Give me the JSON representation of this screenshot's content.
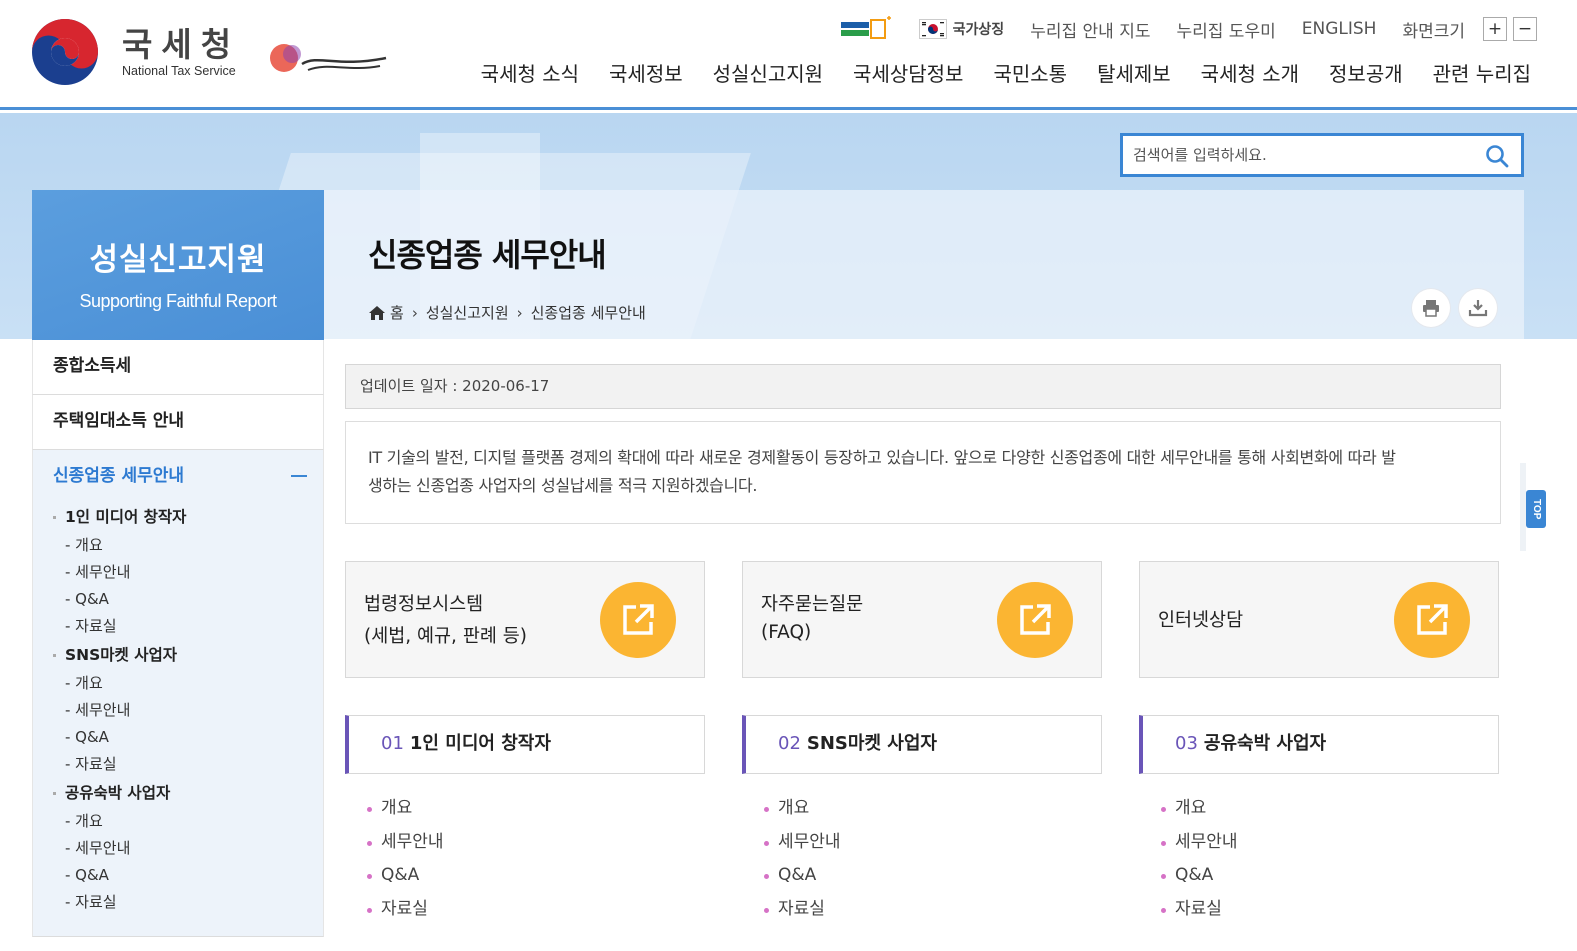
{
  "header": {
    "logo_kr": "국세청",
    "logo_en": "National Tax Service",
    "util": {
      "gov_label": "국가상징",
      "map": "누리집 안내 지도",
      "help": "누리집 도우미",
      "english": "ENGLISH",
      "zoom_label": "화면크기",
      "zoom_in": "+",
      "zoom_out": "−"
    },
    "gnb": [
      "국세청 소식",
      "국세정보",
      "성실신고지원",
      "국세상담정보",
      "국민소통",
      "탈세제보",
      "국세청 소개",
      "정보공개",
      "관련 누리집"
    ]
  },
  "search": {
    "placeholder": "검색어를 입력하세요."
  },
  "side_head": {
    "title": "성실신고지원",
    "subtitle": "Supporting Faithful Report"
  },
  "page": {
    "title": "신종업종 세무안내",
    "breadcrumb": [
      "홈",
      "성실신고지원",
      "신종업종 세무안내"
    ]
  },
  "sidebar": {
    "items": [
      "종합소득세",
      "주택임대소득 안내"
    ],
    "open": {
      "label": "신종업종 세무안내",
      "groups": [
        {
          "title": "1인 미디어 창작자",
          "subs": [
            "- 개요",
            "- 세무안내",
            "- Q&A",
            "- 자료실"
          ]
        },
        {
          "title": "SNS마켓 사업자",
          "subs": [
            "- 개요",
            "- 세무안내",
            "- Q&A",
            "- 자료실"
          ]
        },
        {
          "title": "공유숙박 사업자",
          "subs": [
            "- 개요",
            "- 세무안내",
            "- Q&A",
            "- 자료실"
          ]
        }
      ]
    }
  },
  "content": {
    "update": "업데이트 일자 : 2020-06-17",
    "intro_line1": "IT 기술의 발전, 디지털 플랫폼 경제의 확대에 따라 새로운 경제활동이 등장하고 있습니다. 앞으로 다양한 신종업종에 대한 세무안내를 통해 사회변화에 따라 발",
    "intro_line2": "생하는 신종업종 사업자의 성실납세를 적극 지원하겠습니다.",
    "links": [
      {
        "line1": "법령정보시스템",
        "line2": "(세법, 예규, 판례 등)"
      },
      {
        "line1": "자주묻는질문",
        "line2": "(FAQ)"
      },
      {
        "line1": "인터넷상담",
        "line2": ""
      }
    ],
    "sections": [
      {
        "num": "01",
        "title": "1인 미디어 창작자",
        "items": [
          "개요",
          "세무안내",
          "Q&A",
          "자료실"
        ]
      },
      {
        "num": "02",
        "title": "SNS마켓 사업자",
        "items": [
          "개요",
          "세무안내",
          "Q&A",
          "자료실"
        ]
      },
      {
        "num": "03",
        "title": "공유숙박 사업자",
        "items": [
          "개요",
          "세무안내",
          "Q&A",
          "자료실"
        ]
      }
    ]
  },
  "top_button": "TOP",
  "colors": {
    "primary": "#3a86d4",
    "accent_orange": "#fbb532",
    "section_purple": "#6a55b8",
    "bullet_pink": "#d672c6"
  }
}
